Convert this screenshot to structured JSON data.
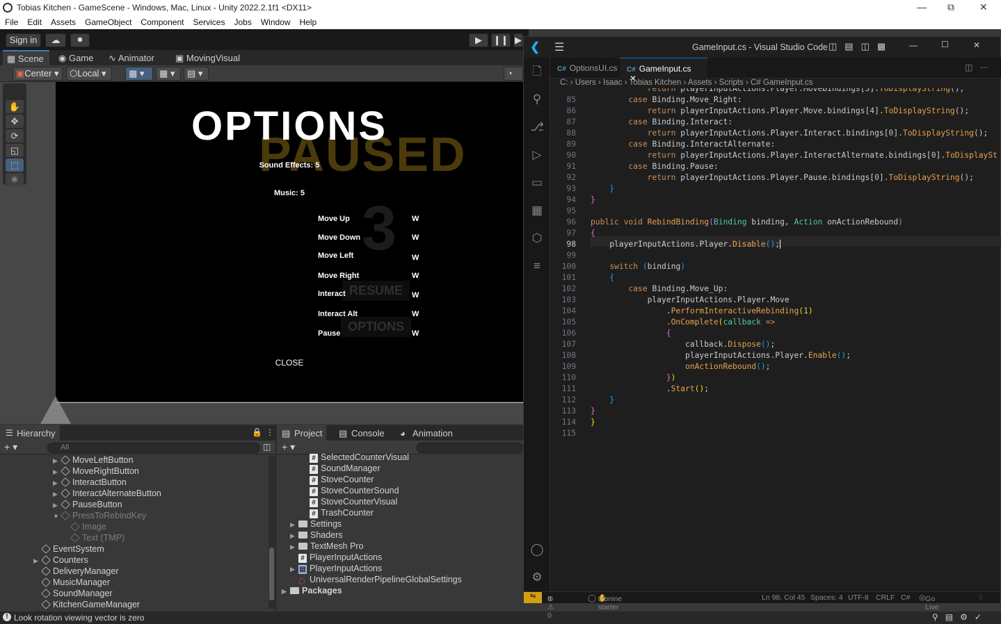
{
  "unity": {
    "title": "Tobias Kitchen - GameScene - Windows, Mac, Linux - Unity 2022.2.1f1 <DX11>",
    "menu": [
      "File",
      "Edit",
      "Assets",
      "GameObject",
      "Component",
      "Services",
      "Jobs",
      "Window",
      "Help"
    ],
    "toolbar": {
      "sign_in": "Sign in"
    },
    "scene_tabs": [
      "Scene",
      "Game",
      "Animator",
      "MovingVisual"
    ],
    "tools": {
      "pivot": "Center",
      "space": "Local"
    },
    "game_ui": {
      "title": "OPTIONS",
      "paused_bg": "PAUSED",
      "number_bg": "3",
      "sound_effects": "Sound Effects: 5",
      "music": "Music: 5",
      "resume_bg": "RESUME",
      "options_bg": "OPTIONS",
      "bindings": [
        {
          "label": "Move Up",
          "key": "W"
        },
        {
          "label": "Move Down",
          "key": "W"
        },
        {
          "label": "Move Left",
          "key": "W"
        },
        {
          "label": "Move Right",
          "key": "W"
        },
        {
          "label": "Interact",
          "key": "W"
        },
        {
          "label": "Interact Alt",
          "key": "W"
        },
        {
          "label": "Pause",
          "key": "W"
        }
      ],
      "close": "CLOSE"
    },
    "hierarchy": {
      "tab": "Hierarchy",
      "search_placeholder": "All",
      "items": [
        "MoveLeftButton",
        "MoveRightButton",
        "InteractButton",
        "InteractAlternateButton",
        "PauseButton",
        "PressToRebindKey",
        "Image",
        "Text (TMP)",
        "EventSystem",
        "Counters",
        "DeliveryManager",
        "MusicManager",
        "SoundManager",
        "KitchenGameManager"
      ]
    },
    "project": {
      "tabs": [
        "Project",
        "Console",
        "Animation"
      ],
      "items": [
        "SelectedCounterVisual",
        "SoundManager",
        "StoveCounter",
        "StoveCounterSound",
        "StoveCounterVisual",
        "TrashCounter",
        "Settings",
        "Shaders",
        "TextMesh Pro",
        "PlayerInputActions",
        "PlayerInputActions",
        "UniversalRenderPipelineGlobalSettings",
        "Packages"
      ]
    },
    "status": "Look rotation viewing vector is zero"
  },
  "vscode": {
    "title": "GameInput.cs - Visual Studio Code",
    "tabs": [
      "OptionsUI.cs",
      "GameInput.cs"
    ],
    "tab_icon": "C#",
    "breadcrumb": [
      "C:",
      "Users",
      "Isaac",
      "Tobias Kitchen",
      "Assets",
      "Scripts",
      "C# GameInput.cs"
    ],
    "line_numbers": [
      "85",
      "86",
      "87",
      "88",
      "89",
      "90",
      "91",
      "92",
      "93",
      "94",
      "95",
      "96",
      "97",
      "98",
      "99",
      "100",
      "101",
      "102",
      "103",
      "104",
      "105",
      "106",
      "107",
      "108",
      "109",
      "110",
      "111",
      "112",
      "113",
      "114",
      "115"
    ],
    "status": {
      "problems": "0 ⚠ 0",
      "tabnine": "tabnine starter",
      "position": "Ln 98, Col 45",
      "spaces": "Spaces: 4",
      "encoding": "UTF-8",
      "eol": "CRLF",
      "language": "C#",
      "golive": "Go Live"
    }
  }
}
